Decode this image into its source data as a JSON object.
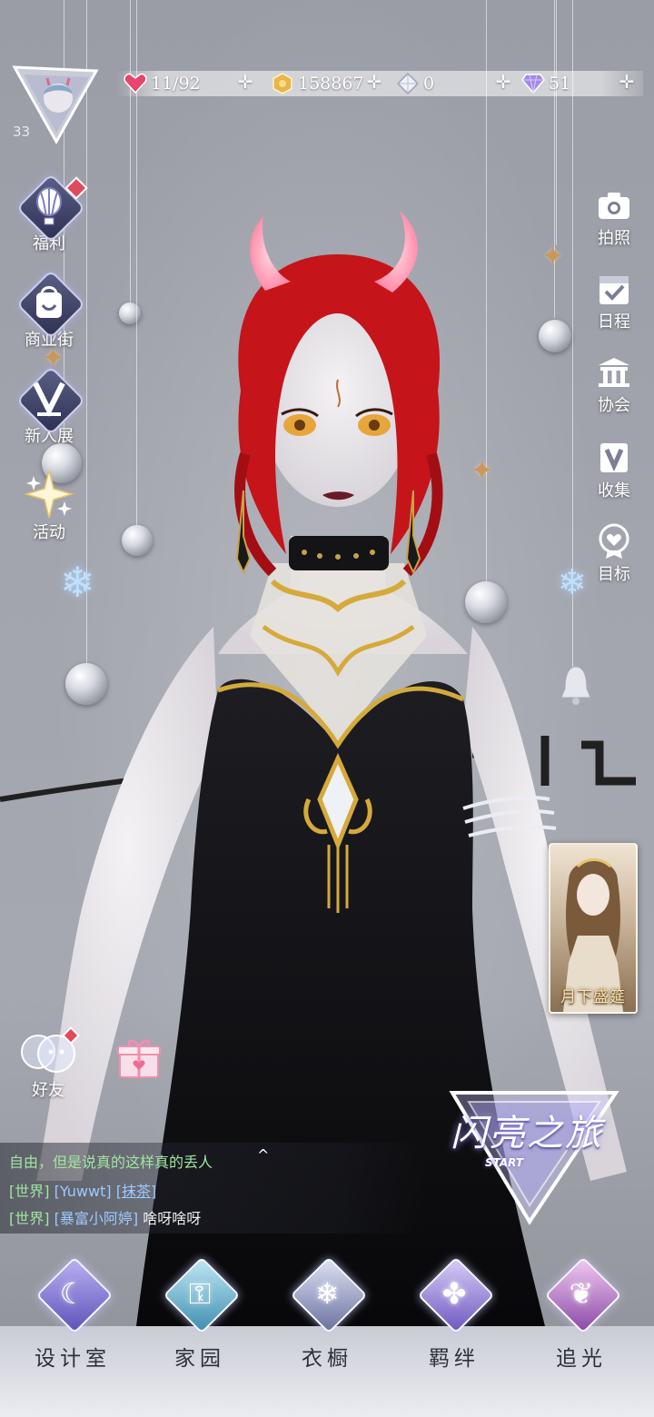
{
  "player": {
    "level": "33"
  },
  "resources": {
    "stamina": {
      "value": "11/92",
      "icon": "heart-gem-icon"
    },
    "gold": {
      "value": "158867",
      "icon": "gold-coin-icon"
    },
    "crystal": {
      "value": "0",
      "icon": "white-diamond-icon"
    },
    "diamond": {
      "value": "51",
      "icon": "purple-diamond-icon"
    }
  },
  "left_menu": [
    {
      "label": "福利",
      "icon": "hot-air-balloon-icon"
    },
    {
      "label": "商业街",
      "icon": "shopping-bag-icon"
    },
    {
      "label": "新人展",
      "icon": "v-crown-icon"
    },
    {
      "label": "活动",
      "icon": "star-burst-icon"
    }
  ],
  "right_menu": [
    {
      "label": "拍照",
      "icon": "camera-icon"
    },
    {
      "label": "日程",
      "icon": "calendar-check-icon"
    },
    {
      "label": "协会",
      "icon": "guild-building-icon"
    },
    {
      "label": "收集",
      "icon": "v-book-icon"
    },
    {
      "label": "目标",
      "icon": "heart-medal-icon"
    }
  ],
  "event_card": {
    "title": "月下盛筵"
  },
  "social": {
    "friends_label": "好友",
    "gift_icon": "gift-box-icon"
  },
  "chat": {
    "line1": "自由，但是说真的这样真的丢人",
    "line2": {
      "channel": "[世界]",
      "user": "[Yuwwt]",
      "message": "[抹茶]"
    },
    "line3": {
      "channel": "[世界]",
      "user": "[暴富小阿婷]",
      "message": "啥呀啥呀"
    }
  },
  "journey_badge": {
    "title": "闪亮之旅",
    "subtitle": "START"
  },
  "bottom_nav": [
    {
      "label": "设计室",
      "icon": "moon-gem-icon",
      "color": "#8b7fe0"
    },
    {
      "label": "家园",
      "icon": "key-gem-icon",
      "color": "#6fb8d8"
    },
    {
      "label": "衣橱",
      "icon": "snowflake-gem-icon",
      "color": "#9aa2c8"
    },
    {
      "label": "羁绊",
      "icon": "clover-gem-icon",
      "color": "#9f8ce0"
    },
    {
      "label": "追光",
      "icon": "butterfly-gem-icon",
      "color": "#c58ad6"
    }
  ],
  "colors": {
    "accent": "#8b7fe0",
    "stamina": "#e8466a",
    "gold": "#e8b54a"
  }
}
